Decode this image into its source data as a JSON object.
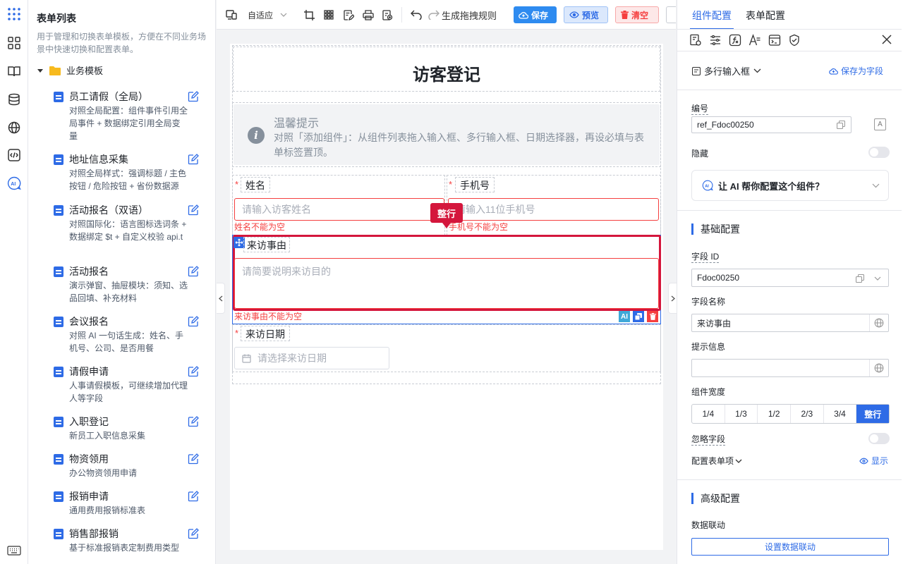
{
  "left_panel": {
    "title": "表单列表",
    "description": "用于管理和切换表单模板，方便在不同业务场景中快速切换和配置表单。",
    "folder": "业务模板",
    "templates": [
      {
        "name": "员工请假（全局）",
        "desc": "对照全局配置：组件事件引用全局事件 + 数据绑定引用全局变量"
      },
      {
        "name": "地址信息采集",
        "desc": "对照全局样式：强调标题 / 主色按钮 / 危险按钮 + 省份数据源"
      },
      {
        "name": "活动报名（双语）",
        "desc": "对照国际化：语言图标选词条 + 数据绑定 $t + 自定义校验 api.t"
      },
      {
        "name": "活动报名",
        "desc": "演示弹窗、抽屉模块：须知、选品回填、补充材料"
      },
      {
        "name": "会议报名",
        "desc": "对照 AI 一句话生成：姓名、手机号、公司、是否用餐"
      },
      {
        "name": "请假申请",
        "desc": "人事请假模板，可继续增加代理人等字段"
      },
      {
        "name": "入职登记",
        "desc": "新员工入职信息采集"
      },
      {
        "name": "物资领用",
        "desc": "办公物资领用申请"
      },
      {
        "name": "报销申请",
        "desc": "通用费用报销标准表"
      },
      {
        "name": "销售部报销",
        "desc": "基于标准报销表定制费用类型"
      }
    ]
  },
  "toolbar": {
    "device_select": "自适应",
    "generate_drag_rules": "生成拖拽规则",
    "save": "保存",
    "preview": "预览",
    "clear": "清空"
  },
  "form": {
    "title": "访客登记",
    "tip_title": "温馨提示",
    "tip_text": "对照「添加组件」：从组件列表拖入输入框、多行输入框、日期选择器，再设必填与表单标签置顶。",
    "name_label": "姓名",
    "name_placeholder": "请输入访客姓名",
    "name_error": "姓名不能为空",
    "phone_label": "手机号",
    "phone_placeholder": "请输入11位手机号",
    "phone_error": "手机号不能为空",
    "width_tag": "整行",
    "reason_label": "来访事由",
    "reason_placeholder": "请简要说明来访目的",
    "reason_error": "来访事由不能为空",
    "date_label": "来访日期",
    "date_placeholder": "请选择来访日期",
    "ai_badge": "AI"
  },
  "right_panel": {
    "tabs": [
      "组件配置",
      "表单配置"
    ],
    "component_type": "多行输入框",
    "save_as_field": "保存为字段",
    "id_label": "编号",
    "id_value": "ref_Fdoc00250",
    "hidden_label": "隐藏",
    "ai_helper": "让 AI 帮你配置这个组件？",
    "basic_section": "基础配置",
    "field_id_label": "字段 ID",
    "field_id_value": "Fdoc00250",
    "field_name_label": "字段名称",
    "field_name_value": "来访事由",
    "hint_label": "提示信息",
    "hint_value": "",
    "width_label": "组件宽度",
    "width_options": [
      "1/4",
      "1/3",
      "1/2",
      "2/3",
      "3/4",
      "整行"
    ],
    "ignore_label": "忽略字段",
    "config_items": "配置表单项",
    "show": "显示",
    "advanced_section": "高级配置",
    "linkage_label": "数据联动",
    "linkage_button": "设置数据联动"
  },
  "colors": {
    "primary": "#2e6be6",
    "danger": "#f53f3f",
    "selected_border": "#d4163c"
  }
}
